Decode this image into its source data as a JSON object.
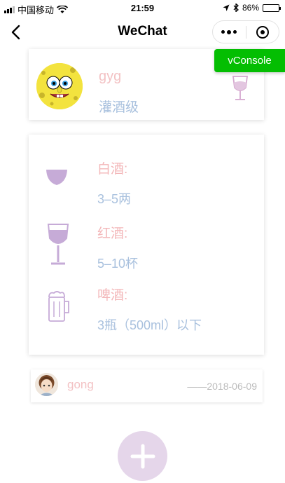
{
  "status_bar": {
    "carrier": "中国移动",
    "time": "21:59",
    "battery_percent": "86%",
    "battery_level": 0.86
  },
  "nav": {
    "title": "WeChat"
  },
  "vconsole": {
    "label": "vConsole",
    "color": "#04be02"
  },
  "profile": {
    "username": "gyg",
    "level": "灌酒级"
  },
  "drinks": [
    {
      "name": "白酒:",
      "amount": "3–5两",
      "icon": "baijiu-cup-icon"
    },
    {
      "name": "红酒:",
      "amount": "5–10杯",
      "icon": "wine-glass-icon"
    },
    {
      "name": "啤酒:",
      "amount": "3瓶（500ml）以下",
      "icon": "beer-mug-icon"
    }
  ],
  "post": {
    "username": "gong",
    "date": "——2018-06-09"
  },
  "colors": {
    "accent_pink": "#f3b7b9",
    "accent_blue": "#a9c1de",
    "icon_purple": "#c9b3d9",
    "add_button": "#e5d6ea"
  }
}
